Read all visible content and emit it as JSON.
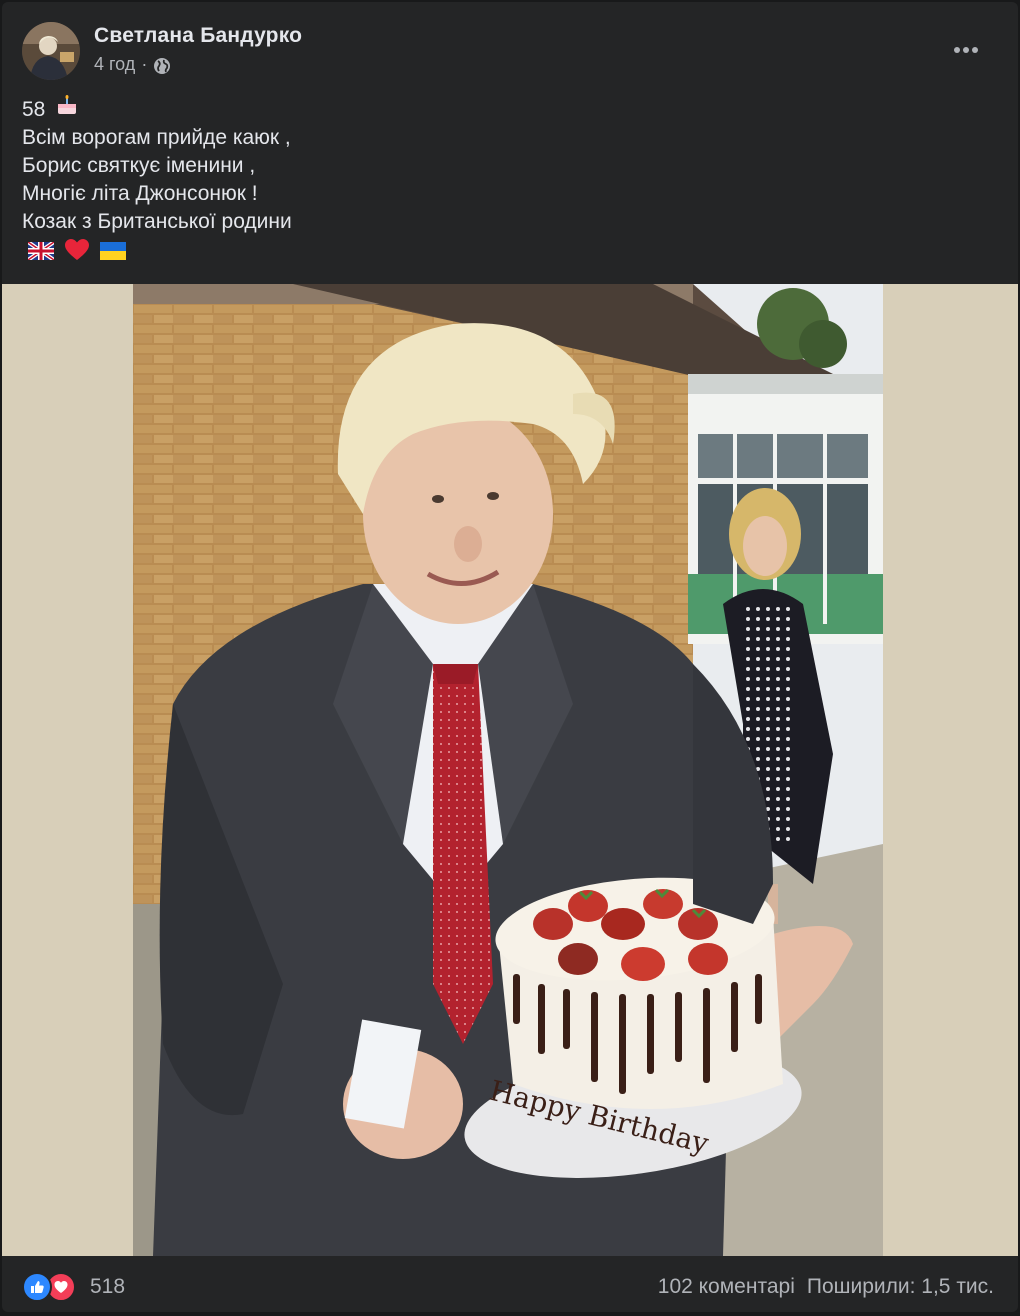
{
  "post": {
    "author": "Светлана Бандурко",
    "timestamp": "4 год",
    "separator": "·",
    "audience_icon": "globe-icon",
    "more_icon": "more-options-icon",
    "text_lines": [
      "58",
      "Всім ворогам прийде каюк ,",
      "Борис святкує іменини ,",
      "Многіє літа Джонсонюк !",
      "Козак з Британської родини"
    ],
    "emojis": [
      "birthday-cake-emoji",
      "uk-flag-emoji",
      "red-heart-emoji",
      "ukraine-flag-emoji"
    ]
  },
  "photo": {
    "cake_text": "Happy Birthday"
  },
  "footer": {
    "reaction_icons": [
      "like-icon",
      "love-icon"
    ],
    "reaction_count": "518",
    "comments": "102 коментарі",
    "shares": "Поширили: 1,5 тис."
  },
  "colors": {
    "card_bg": "#242526",
    "page_bg": "#18191a",
    "text_primary": "#e4e6eb",
    "text_secondary": "#b0b3b8",
    "like_blue": "#2d88ff",
    "love_red": "#f33e58"
  }
}
